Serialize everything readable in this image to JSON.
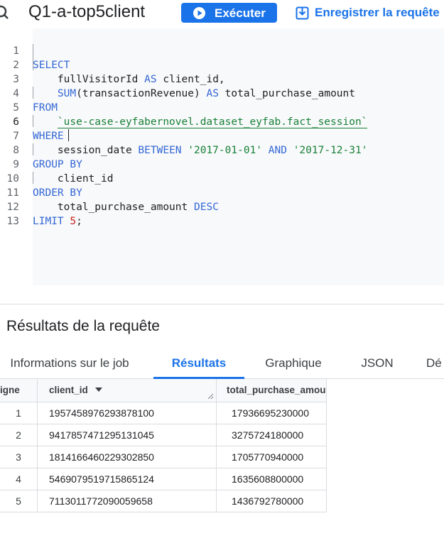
{
  "header": {
    "query_name": "Q1-a-top5client",
    "run_label": "Exécuter",
    "save_label": "Enregistrer la requête"
  },
  "editor": {
    "line_numbers": [
      "1",
      "2",
      "3",
      "4",
      "5",
      "6",
      "7",
      "8",
      "9",
      "10",
      "11",
      "12",
      "13"
    ],
    "active_line": 6,
    "code": {
      "l1_kw": "SELECT",
      "l2_field": "fullVisitorId",
      "l2_as": "AS",
      "l2_alias": "client_id,",
      "l3_fn": "SUM",
      "l3_arg": "(transactionRevenue)",
      "l3_as": "AS",
      "l3_alias": "total_purchase_amount",
      "l4_kw": "FROM",
      "l5_table": "`use-case-eyfabernovel.dataset_eyfab.fact_session`",
      "l6_kw": "WHERE",
      "l7_field": "session_date",
      "l7_kw1": "BETWEEN",
      "l7_str1": "'2017-01-01'",
      "l7_kw2": "AND",
      "l7_str2": "'2017-12-31'",
      "l8_kw": "GROUP BY",
      "l9_field": "client_id",
      "l10_kw": "ORDER BY",
      "l11_field": "total_purchase_amount",
      "l11_kw": "DESC",
      "l12_kw": "LIMIT",
      "l12_num": "5",
      "l12_end": ";"
    }
  },
  "results": {
    "title": "Résultats de la requête",
    "tabs": [
      {
        "label": "Informations sur le job"
      },
      {
        "label": "Résultats"
      },
      {
        "label": "Graphique"
      },
      {
        "label": "JSON"
      },
      {
        "label": "Dé"
      }
    ],
    "active_tab": "Résultats",
    "columns": [
      "igne",
      "client_id",
      "total_purchase_amou"
    ],
    "rows": [
      {
        "n": "1",
        "client_id": "1957458976293878100",
        "total": "17936695230000"
      },
      {
        "n": "2",
        "client_id": "9417857471295131045",
        "total": "3275724180000"
      },
      {
        "n": "3",
        "client_id": "1814166460229302850",
        "total": "1705770940000"
      },
      {
        "n": "4",
        "client_id": "5469079519715865124",
        "total": "1635608800000"
      },
      {
        "n": "5",
        "client_id": "7113011772090059658",
        "total": "1436792780000"
      }
    ]
  },
  "colors": {
    "accent": "#1a73e8",
    "keyword": "#3367d6",
    "string": "#188038",
    "number": "#c5221f"
  },
  "icons": {
    "query": "magnifier-query-icon",
    "run": "play-icon",
    "save": "save-icon",
    "sort": "sort-desc-icon",
    "resize": "column-resize-icon"
  }
}
